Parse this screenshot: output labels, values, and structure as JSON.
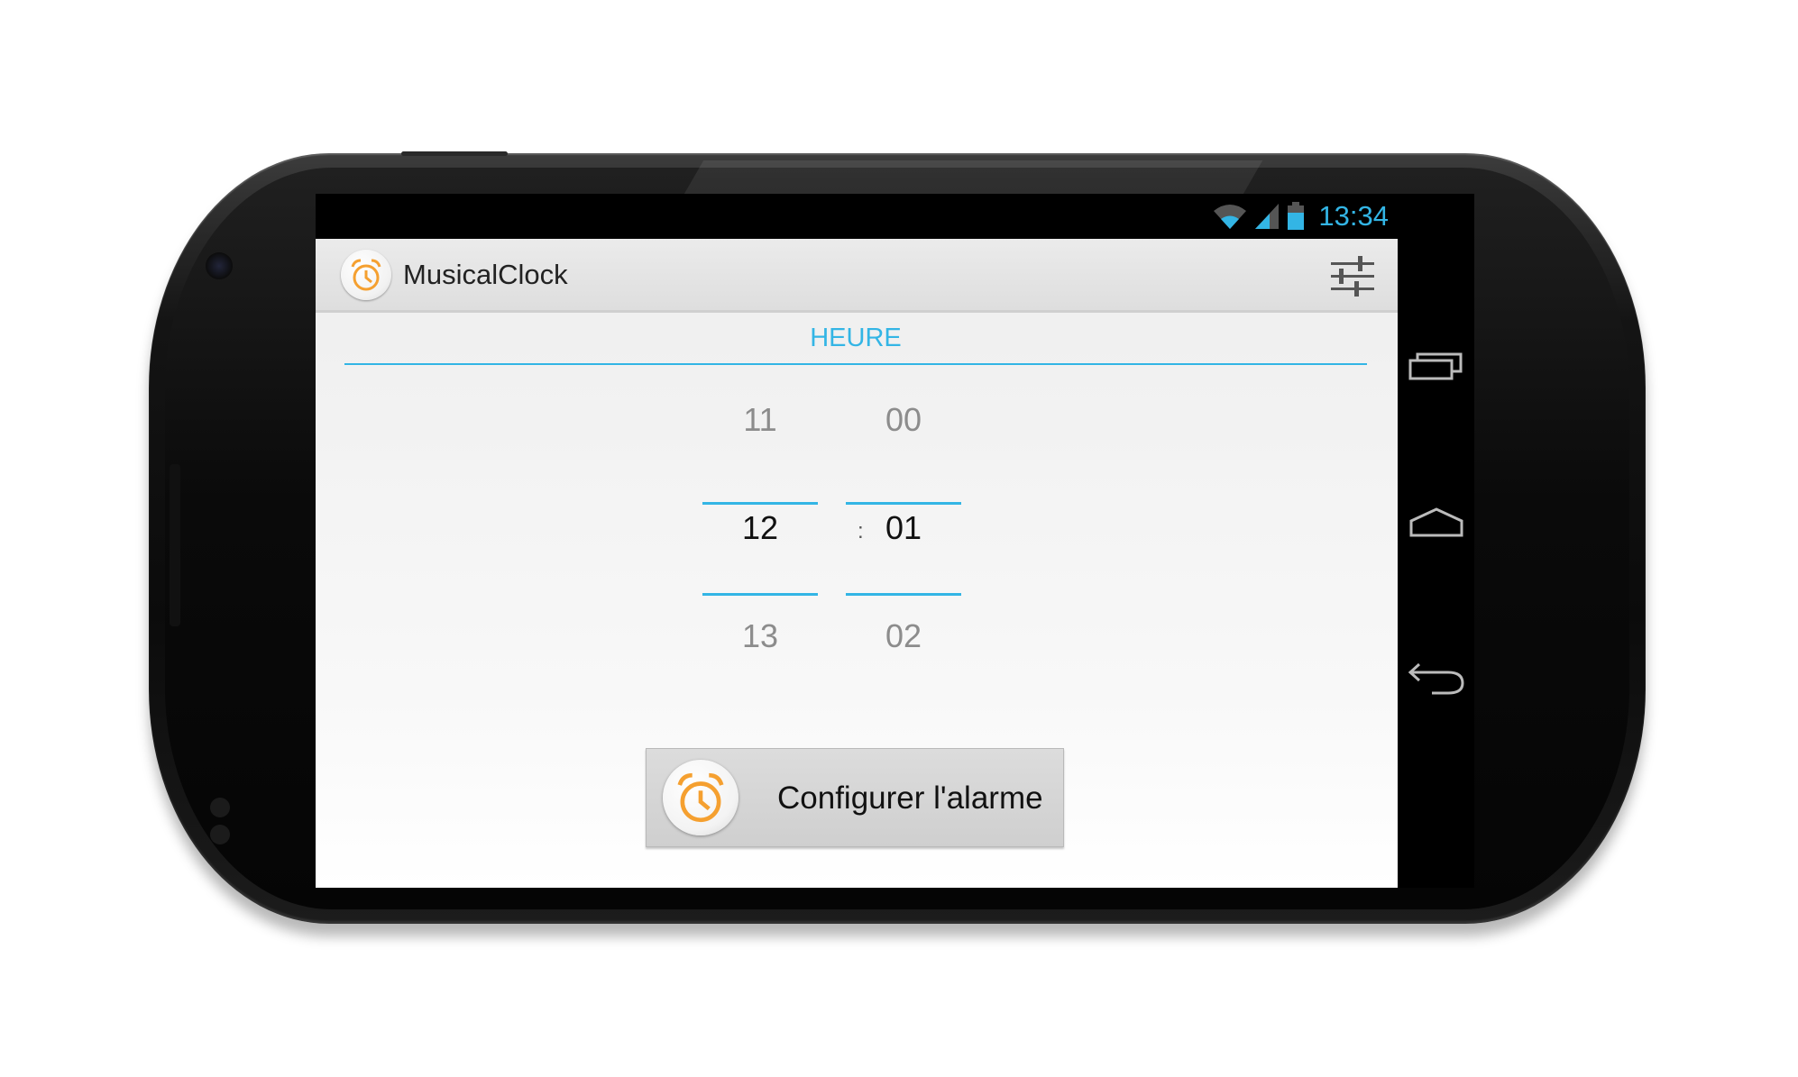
{
  "status_bar": {
    "time": "13:34"
  },
  "action_bar": {
    "title": "MusicalClock"
  },
  "section": {
    "title": "HEURE"
  },
  "time_picker": {
    "hours": {
      "prev": "11",
      "current": "12",
      "next": "13"
    },
    "separator": ":",
    "minutes": {
      "prev": "00",
      "current": "01",
      "next": "02"
    }
  },
  "alarm_button": {
    "label": "Configurer l'alarme"
  },
  "colors": {
    "accent": "#33b5e5",
    "alarm_icon": "#f5a030"
  },
  "icons": [
    "wifi-icon",
    "signal-icon",
    "battery-icon",
    "alarm-clock-icon",
    "settings-sliders-icon",
    "recent-apps-icon",
    "home-icon",
    "back-icon"
  ]
}
